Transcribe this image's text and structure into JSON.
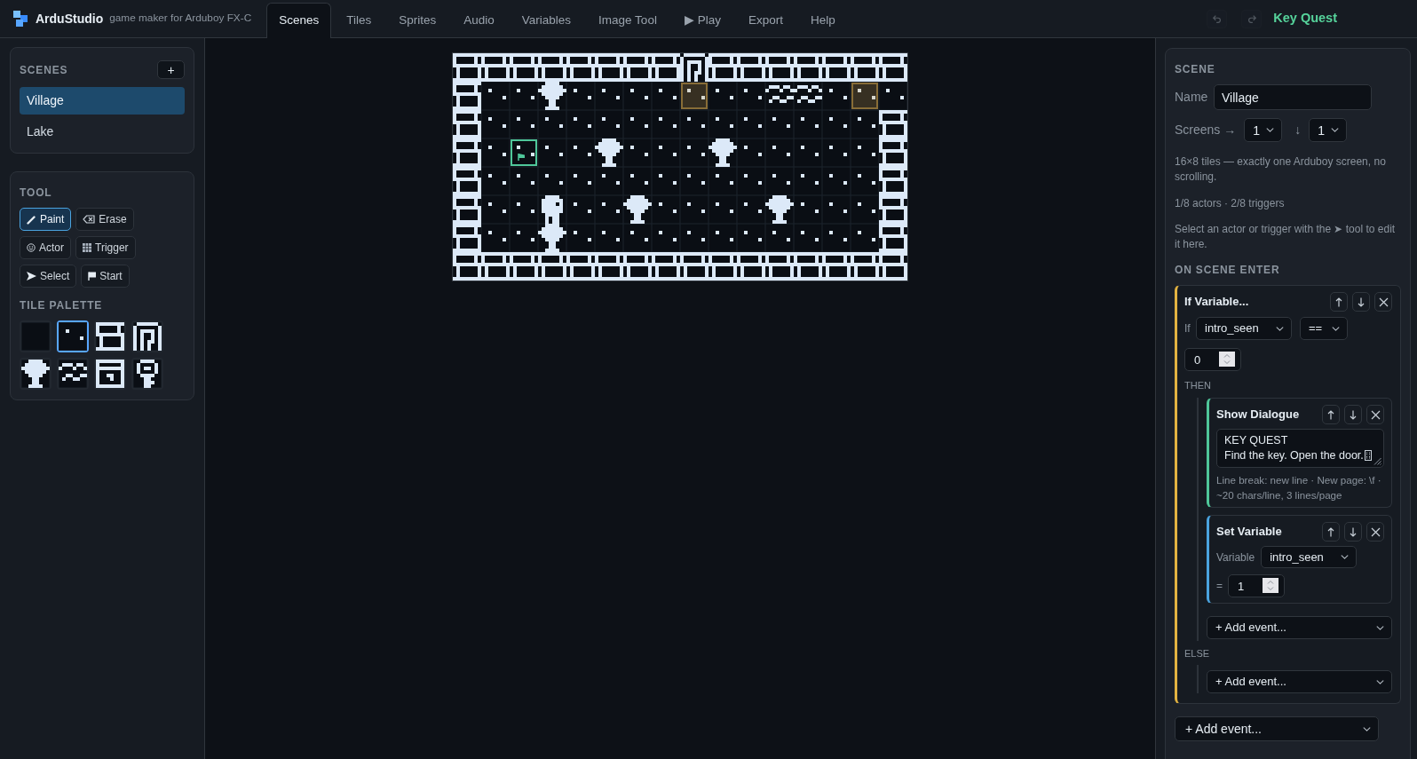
{
  "app": {
    "name": "ArduStudio",
    "tagline": "game maker for Arduboy FX-C"
  },
  "tabs": [
    {
      "label": "Scenes",
      "selected": true
    },
    {
      "label": "Tiles",
      "selected": false
    },
    {
      "label": "Sprites",
      "selected": false
    },
    {
      "label": "Audio",
      "selected": false
    },
    {
      "label": "Variables",
      "selected": false
    },
    {
      "label": "Image Tool",
      "selected": false
    },
    {
      "label": "▶ Play",
      "selected": false
    },
    {
      "label": "Export",
      "selected": false
    },
    {
      "label": "Help",
      "selected": false
    }
  ],
  "history": {
    "undo": {
      "disabled": true
    },
    "redo": {
      "disabled": true
    }
  },
  "project": {
    "title": "Key Quest"
  },
  "scenes": {
    "title": "SCENES",
    "add_label": "+",
    "items": [
      {
        "label": "Village",
        "selected": true
      },
      {
        "label": "Lake",
        "selected": false
      }
    ]
  },
  "tools": {
    "title": "TOOL",
    "items": [
      {
        "kind": "paint",
        "label": "Paint",
        "selected": true
      },
      {
        "kind": "erase",
        "label": "Erase",
        "selected": false
      },
      {
        "kind": "actor",
        "label": "Actor",
        "selected": false
      },
      {
        "kind": "trigger",
        "label": "Trigger",
        "selected": false
      },
      {
        "kind": "select",
        "label": "Select",
        "selected": false
      },
      {
        "kind": "start",
        "label": "Start",
        "selected": false
      }
    ]
  },
  "palette": {
    "title": "TILE PALETTE",
    "tiles": [
      {
        "kind": "blank",
        "selected": false
      },
      {
        "kind": "dots",
        "selected": true
      },
      {
        "kind": "brick",
        "selected": false
      },
      {
        "kind": "spiral",
        "selected": false
      },
      {
        "kind": "tree",
        "selected": false
      },
      {
        "kind": "waves",
        "selected": false
      },
      {
        "kind": "chest",
        "selected": false
      },
      {
        "kind": "key",
        "selected": false
      }
    ]
  },
  "map": {
    "rows": [
      [
        {
          "kind": "brick"
        },
        {
          "kind": "brick"
        },
        {
          "kind": "brick"
        },
        {
          "kind": "brick"
        },
        {
          "kind": "brick"
        },
        {
          "kind": "brick"
        },
        {
          "kind": "brick"
        },
        {
          "kind": "brick"
        },
        {
          "kind": "spiral"
        },
        {
          "kind": "brick"
        },
        {
          "kind": "brick"
        },
        {
          "kind": "brick"
        },
        {
          "kind": "brick"
        },
        {
          "kind": "brick"
        },
        {
          "kind": "brick"
        },
        {
          "kind": "brick"
        }
      ],
      [
        {
          "kind": "brick"
        },
        {
          "kind": "dots"
        },
        {
          "kind": "dots"
        },
        {
          "kind": "tree"
        },
        {
          "kind": "dots"
        },
        {
          "kind": "dots"
        },
        {
          "kind": "dots"
        },
        {
          "kind": "dots"
        },
        {
          "kind": "dots",
          "overlay": {
            "kind": "trigger"
          }
        },
        {
          "kind": "dots"
        },
        {
          "kind": "dots"
        },
        {
          "kind": "waves"
        },
        {
          "kind": "waves"
        },
        {
          "kind": "dots"
        },
        {
          "kind": "dots",
          "overlay": {
            "kind": "trigger"
          }
        },
        {
          "kind": "dots"
        }
      ],
      [
        {
          "kind": "brick"
        },
        {
          "kind": "dots"
        },
        {
          "kind": "dots"
        },
        {
          "kind": "dots"
        },
        {
          "kind": "dots"
        },
        {
          "kind": "dots"
        },
        {
          "kind": "dots"
        },
        {
          "kind": "dots"
        },
        {
          "kind": "dots"
        },
        {
          "kind": "dots"
        },
        {
          "kind": "dots"
        },
        {
          "kind": "dots"
        },
        {
          "kind": "dots"
        },
        {
          "kind": "dots"
        },
        {
          "kind": "dots"
        },
        {
          "kind": "brick"
        }
      ],
      [
        {
          "kind": "brick"
        },
        {
          "kind": "dots"
        },
        {
          "kind": "dots",
          "overlay": {
            "kind": "start"
          }
        },
        {
          "kind": "dots"
        },
        {
          "kind": "dots"
        },
        {
          "kind": "tree"
        },
        {
          "kind": "dots"
        },
        {
          "kind": "dots"
        },
        {
          "kind": "dots"
        },
        {
          "kind": "tree"
        },
        {
          "kind": "dots"
        },
        {
          "kind": "dots"
        },
        {
          "kind": "dots"
        },
        {
          "kind": "dots"
        },
        {
          "kind": "dots"
        },
        {
          "kind": "brick"
        }
      ],
      [
        {
          "kind": "brick"
        },
        {
          "kind": "dots"
        },
        {
          "kind": "dots"
        },
        {
          "kind": "dots"
        },
        {
          "kind": "dots"
        },
        {
          "kind": "dots"
        },
        {
          "kind": "dots"
        },
        {
          "kind": "dots"
        },
        {
          "kind": "dots"
        },
        {
          "kind": "dots"
        },
        {
          "kind": "dots"
        },
        {
          "kind": "dots"
        },
        {
          "kind": "dots"
        },
        {
          "kind": "dots"
        },
        {
          "kind": "dots"
        },
        {
          "kind": "brick"
        }
      ],
      [
        {
          "kind": "brick"
        },
        {
          "kind": "dots"
        },
        {
          "kind": "dots"
        },
        {
          "kind": "dots",
          "overlay": {
            "kind": "actor"
          }
        },
        {
          "kind": "dots"
        },
        {
          "kind": "dots"
        },
        {
          "kind": "tree"
        },
        {
          "kind": "dots"
        },
        {
          "kind": "dots"
        },
        {
          "kind": "dots"
        },
        {
          "kind": "dots"
        },
        {
          "kind": "tree"
        },
        {
          "kind": "dots"
        },
        {
          "kind": "dots"
        },
        {
          "kind": "dots"
        },
        {
          "kind": "brick"
        }
      ],
      [
        {
          "kind": "brick"
        },
        {
          "kind": "dots"
        },
        {
          "kind": "dots"
        },
        {
          "kind": "tree"
        },
        {
          "kind": "dots"
        },
        {
          "kind": "dots"
        },
        {
          "kind": "dots"
        },
        {
          "kind": "dots"
        },
        {
          "kind": "dots"
        },
        {
          "kind": "dots"
        },
        {
          "kind": "dots"
        },
        {
          "kind": "dots"
        },
        {
          "kind": "dots"
        },
        {
          "kind": "dots"
        },
        {
          "kind": "dots"
        },
        {
          "kind": "brick"
        }
      ],
      [
        {
          "kind": "brick"
        },
        {
          "kind": "brick"
        },
        {
          "kind": "brick"
        },
        {
          "kind": "brick"
        },
        {
          "kind": "brick"
        },
        {
          "kind": "brick"
        },
        {
          "kind": "brick"
        },
        {
          "kind": "brick"
        },
        {
          "kind": "brick"
        },
        {
          "kind": "brick"
        },
        {
          "kind": "brick"
        },
        {
          "kind": "brick"
        },
        {
          "kind": "brick"
        },
        {
          "kind": "brick"
        },
        {
          "kind": "brick"
        },
        {
          "kind": "brick"
        }
      ]
    ]
  },
  "inspector": {
    "title": "SCENE",
    "name_label": "Name",
    "name_value": "Village",
    "screens_label": "Screens →",
    "screens_across": "1",
    "down_label": "↓",
    "screens_down": "1",
    "size_note": "16×8 tiles — exactly one Arduboy screen, no scrolling.",
    "counts": "1/8 actors · 2/8 triggers",
    "hint": "Select an actor or trigger with the ➤ tool to edit it here.",
    "on_enter": {
      "title": "ON SCENE ENTER",
      "add_label": "+ Add event...",
      "events": [
        {
          "kind": "if_variable",
          "title": "If Variable...",
          "if_label": "If",
          "variable": "intro_seen",
          "operator": "==",
          "value": "0",
          "then_label": "THEN",
          "then": [
            {
              "kind": "show_dialogue",
              "title": "Show Dialogue",
              "text": "KEY QUEST\nFind the key. Open the door.\f",
              "note": "Line break: new line · New page: \\f · ~20 chars/line, 3 lines/page"
            },
            {
              "kind": "set_variable",
              "title": "Set Variable",
              "variable_label": "Variable",
              "variable": "intro_seen",
              "equals_label": "=",
              "value": "1"
            }
          ],
          "then_add_label": "+ Add event...",
          "else_label": "ELSE",
          "else_add_label": "+ Add event..."
        }
      ]
    }
  }
}
